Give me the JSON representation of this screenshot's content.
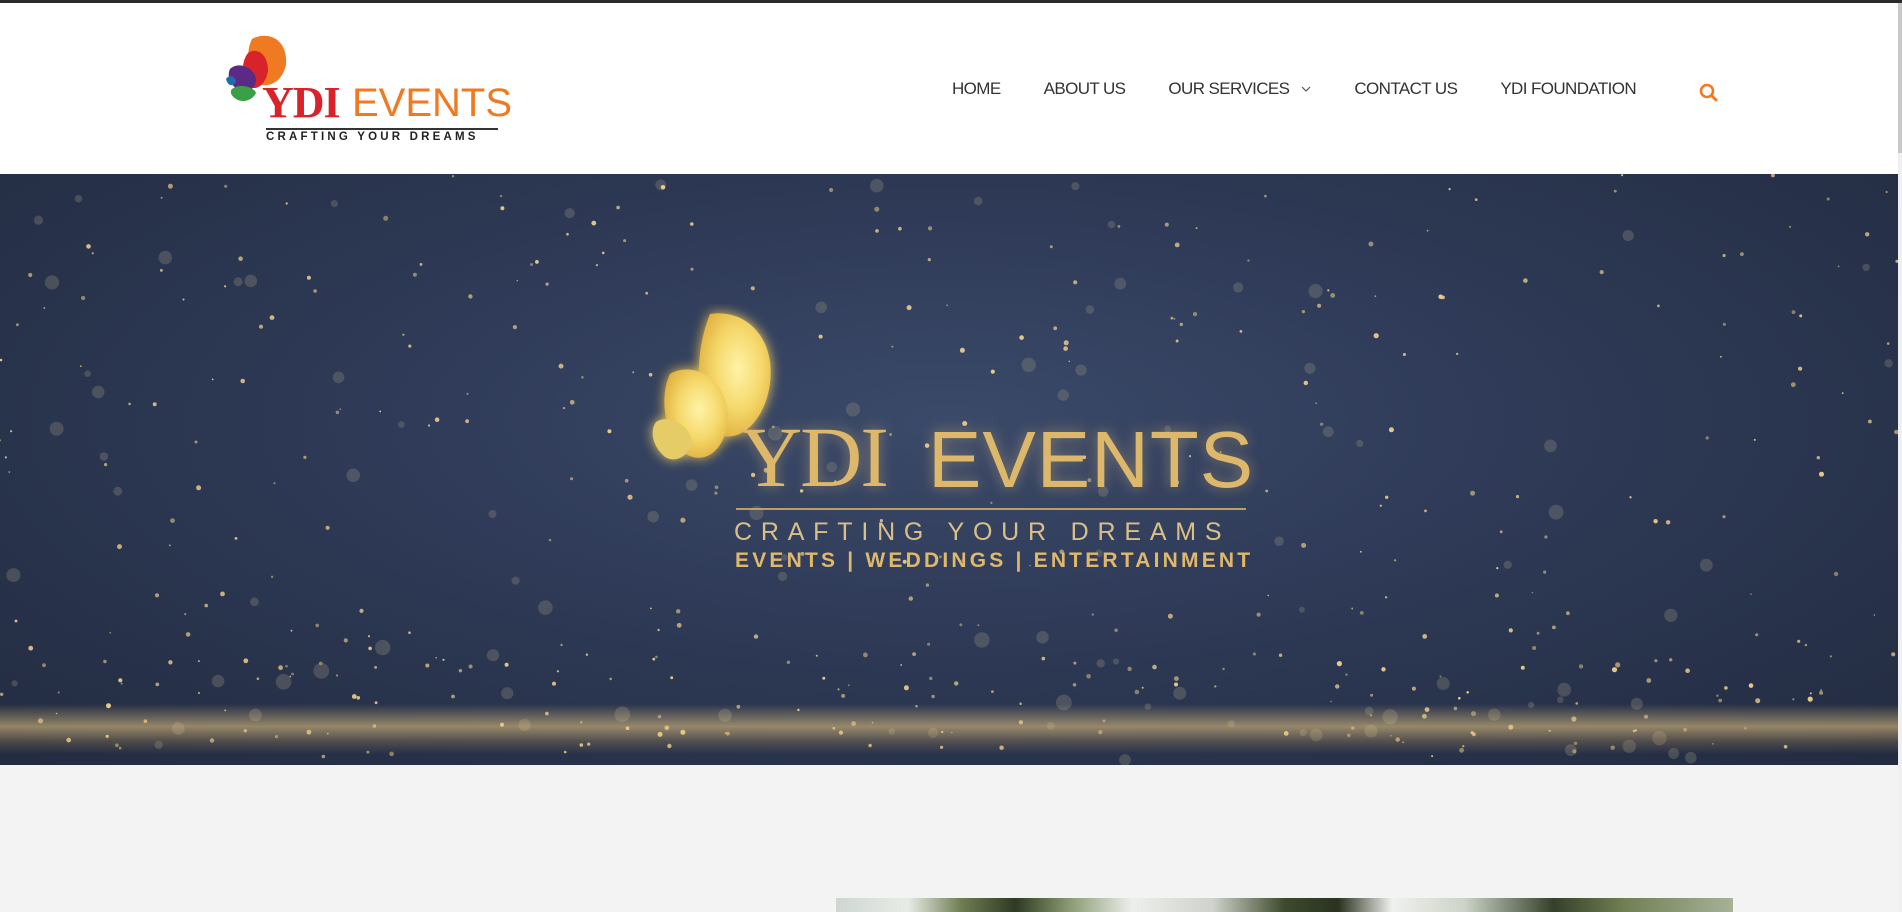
{
  "brand": {
    "name_part1": "YDI",
    "name_part2": "EVENTS",
    "tagline": "CRAFTING YOUR DREAMS",
    "colors": {
      "red": "#d8232a",
      "orange": "#f07a22",
      "green": "#3aa046",
      "purple": "#5b2a86",
      "gold": "#ddb86a"
    }
  },
  "nav": {
    "items": [
      {
        "label": "HOME"
      },
      {
        "label": "ABOUT US"
      },
      {
        "label": "OUR SERVICES",
        "has_dropdown": true
      },
      {
        "label": "CONTACT US"
      },
      {
        "label": "YDI FOUNDATION"
      }
    ],
    "search_icon": "search-icon",
    "dropdown_icon": "chevron-down-icon"
  },
  "hero": {
    "logo_part1": "YDI",
    "logo_part2": "EVENTS",
    "tagline": "CRAFTING YOUR DREAMS",
    "subline": "EVENTS | WEDDINGS | ENTERTAINMENT"
  }
}
